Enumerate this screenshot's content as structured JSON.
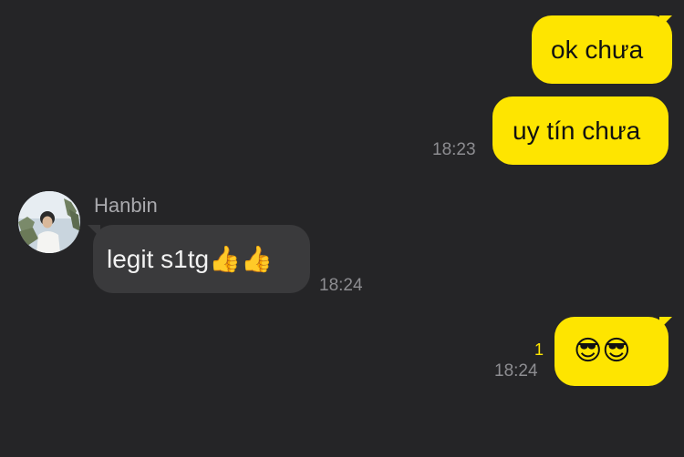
{
  "messages": [
    {
      "direction": "out",
      "text": "ok chưa"
    },
    {
      "direction": "out",
      "text": "uy tín chưa",
      "time": "18:23"
    },
    {
      "direction": "in",
      "sender": "Hanbin",
      "text": "legit s1tg",
      "emoji": "👍👍",
      "time": "18:24"
    },
    {
      "direction": "out",
      "emoji": "😎😎",
      "time": "18:24",
      "unread_count": "1"
    }
  ],
  "colors": {
    "background": "#252527",
    "outgoing_bubble": "#fee500",
    "incoming_bubble": "#3a3a3c",
    "timestamp": "#8d8d91"
  },
  "icons": {
    "avatar": "profile-photo-avatar"
  }
}
